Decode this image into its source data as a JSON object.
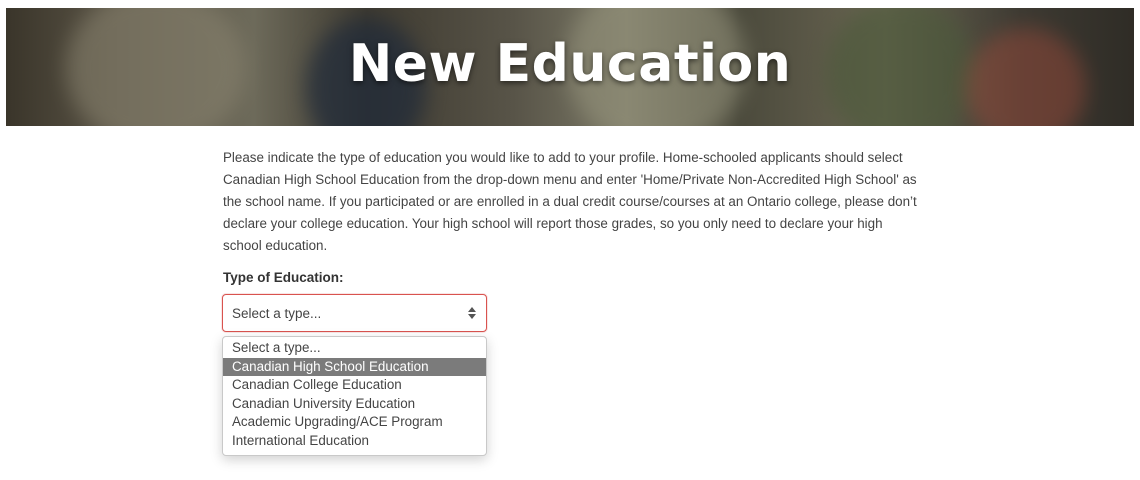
{
  "hero": {
    "title": "New Education"
  },
  "intro": {
    "text": "Please indicate the type of education you would like to add to your profile. Home-schooled applicants should select Canadian High School Education from the drop-down menu and enter 'Home/Private Non-Accredited High School' as the school name. If you participated or are enrolled in a dual credit course/courses at an Ontario college, please don’t declare your college education. Your high school will report those grades, so you only need to declare your high school education."
  },
  "form": {
    "type_label": "Type of Education:",
    "select_value": "Select a type...",
    "options": [
      "Select a type...",
      "Canadian High School Education",
      "Canadian College Education",
      "Canadian University Education",
      "Academic Upgrading/ACE Program",
      "International Education"
    ],
    "highlighted_option": "Canadian High School Education"
  },
  "colors": {
    "error_border": "#d9534f",
    "highlight_bg": "#7b7b7b",
    "text": "#444444"
  },
  "icons": {
    "select_arrows": "sort-arrows-icon"
  }
}
